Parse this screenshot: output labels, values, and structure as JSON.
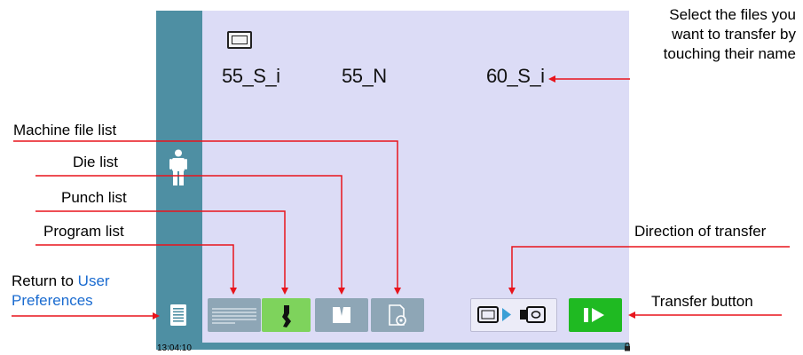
{
  "status": {
    "time": "13:04:10"
  },
  "files": [
    "55_S_i",
    "55_N",
    "60_S_i"
  ],
  "toolbar": {
    "back": "return-to-user-preferences",
    "program_list": "program-list",
    "punch_list": "punch-list",
    "die_list": "die-list",
    "machine_file_list": "machine-file-list",
    "direction": "direction-of-transfer",
    "transfer": "transfer-button"
  },
  "annotations": {
    "select_files_1": "Select the files you",
    "select_files_2": "want to transfer by",
    "select_files_3": "touching their name",
    "machine_file_list": "Machine file list",
    "die_list": "Die list",
    "punch_list": "Punch list",
    "program_list": "Program list",
    "direction_of_transfer": "Direction of transfer",
    "return_to": "Return to",
    "user": "User",
    "preferences": "Preferences",
    "transfer_button": "Transfer button"
  },
  "colors": {
    "sidebar": "#4e8fa3",
    "main_bg": "#dcdcf6",
    "grey_button": "#8ea6b6",
    "active_button": "#7ed35c",
    "transfer_button": "#1fba22",
    "arrow": "#e8141c",
    "link": "#1a6bd0"
  }
}
